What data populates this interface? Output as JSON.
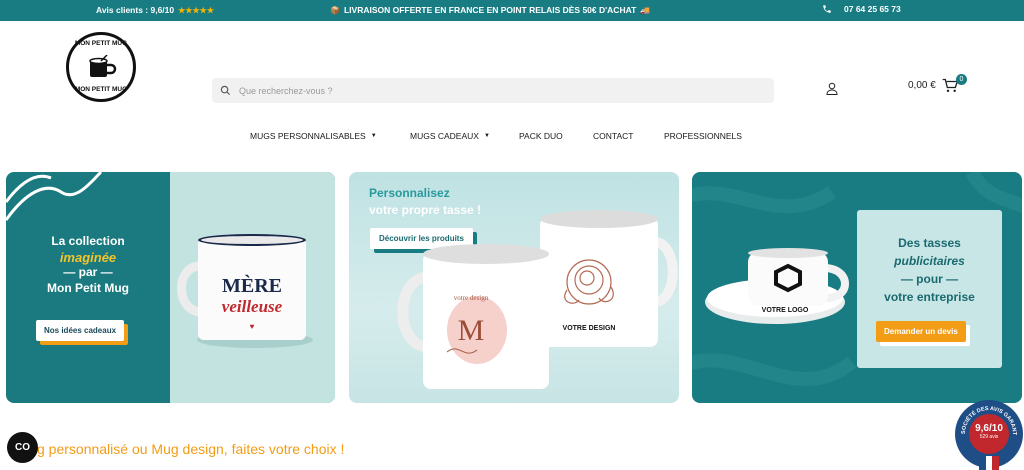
{
  "topbar": {
    "reviews_label": "Avis clients : 9,6/10",
    "stars": "★★★★★",
    "shipping": "LIVRAISON OFFERTE EN FRANCE EN POINT RELAIS DÈS 50€ D'ACHAT",
    "phone": "07 64 25 65 73"
  },
  "logo": {
    "top_text": "MON PETIT MUG",
    "bottom_text": "MON PETIT MUG"
  },
  "search": {
    "placeholder": "Que recherchez-vous ?"
  },
  "cart": {
    "total": "0,00 €",
    "count": "0"
  },
  "nav": {
    "items": [
      "MUGS PERSONNALISABLES",
      "MUGS CADEAUX",
      "PACK DUO",
      "CONTACT",
      "PROFESSIONNELS"
    ]
  },
  "banner1": {
    "line1": "La collection",
    "line2": "imaginée",
    "line3": "— par —",
    "line4": "Mon Petit Mug",
    "button": "Nos idées cadeaux",
    "mug_text1": "MÈRE",
    "mug_text2": "veilleuse"
  },
  "banner2": {
    "line1": "Personnalisez",
    "line2": "votre propre tasse !",
    "button": "Découvrir les produits",
    "mug_left_small": "votre design",
    "mug_left_letter": "M",
    "mug_right_text": "VOTRE DESIGN"
  },
  "banner3": {
    "line1": "Des tasses",
    "line2": "publicitaires",
    "line3": "— pour —",
    "line4": "votre entreprise",
    "button": "Demander un devis",
    "cup_text": "VOTRE LOGO"
  },
  "headline": "g personnalisé ou Mug design, faites votre choix !",
  "seal": {
    "score": "9,6/10",
    "count": "529 avis",
    "ring_text": "SOCIÉTÉ DES AVIS GARANTIS"
  },
  "colors": {
    "brand": "#197c82",
    "accent": "#f39c16"
  }
}
